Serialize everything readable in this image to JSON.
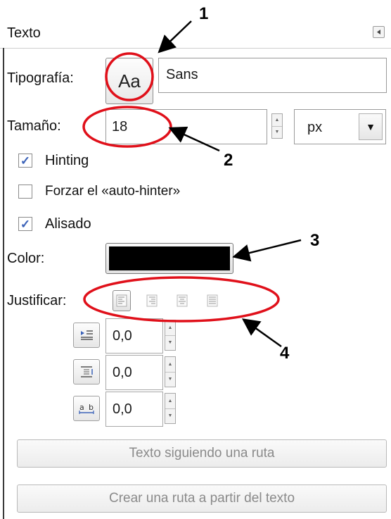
{
  "panel": {
    "title": "Texto",
    "collapse_icon": "triangle-left-icon"
  },
  "font": {
    "label": "Tipografía:",
    "preview_glyph": "Aa",
    "value": "Sans"
  },
  "size": {
    "label": "Tamaño:",
    "value": "18",
    "unit": "px"
  },
  "options": {
    "hinting_label": "Hinting",
    "hinting_checked": true,
    "autohinter_label": "Forzar el «auto-hinter»",
    "autohinter_checked": false,
    "antialias_label": "Alisado",
    "antialias_checked": true
  },
  "color": {
    "label": "Color:",
    "value": "#000000"
  },
  "justify": {
    "label": "Justificar:",
    "buttons": [
      "justify-left-icon",
      "justify-right-icon",
      "justify-center-icon",
      "justify-fill-icon"
    ],
    "active": 0
  },
  "spacing": {
    "indent": "0,0",
    "line_spacing": "0,0",
    "letter_spacing": "0,0"
  },
  "actions": {
    "text_along_path": "Texto siguiendo una ruta",
    "path_from_text": "Crear una ruta a partir del texto"
  },
  "annotations": {
    "n1": "1",
    "n2": "2",
    "n3": "3",
    "n4": "4",
    "color": "#e0101a"
  }
}
